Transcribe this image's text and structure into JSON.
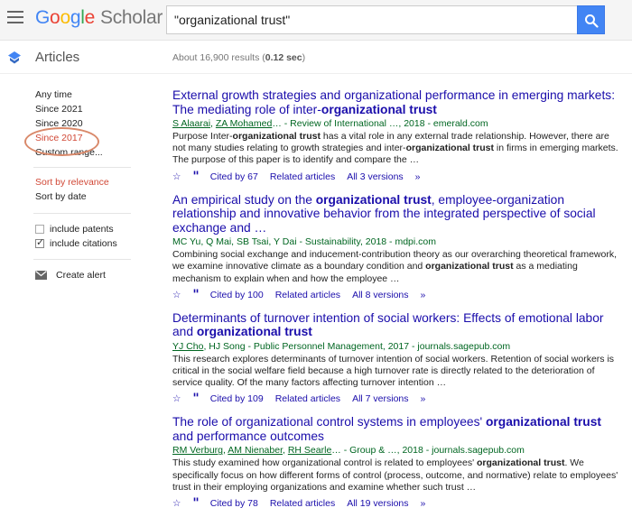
{
  "header": {
    "logo": {
      "g1": "G",
      "g2": "o",
      "g3": "o",
      "g4": "g",
      "g5": "l",
      "g6": "e",
      "scholar": "Scholar"
    },
    "search_value": "\"organizational trust\""
  },
  "subbar": {
    "section_label": "Articles",
    "results_prefix": "About 16,900 results (",
    "results_time": "0.12 sec",
    "results_suffix": ")"
  },
  "sidebar": {
    "time_filters": [
      "Any time",
      "Since 2021",
      "Since 2020",
      "Since 2017",
      "Custom range..."
    ],
    "sort_options": [
      "Sort by relevance",
      "Sort by date"
    ],
    "checkboxes": [
      {
        "label": "include patents",
        "checked": false
      },
      {
        "label": "include citations",
        "checked": true
      }
    ],
    "create_alert": "Create alert"
  },
  "results": [
    {
      "title_parts": [
        "External growth strategies and organizational performance in emerging markets: The mediating role of inter-",
        "organizational trust",
        ""
      ],
      "authors": [
        "S Alaarai",
        "ZA Mohamed"
      ],
      "author_sep": ", ",
      "meta_rest": "… - Review of International …, 2018 - emerald.com",
      "snippet_parts": [
        "Purpose Inter-",
        "organizational trust",
        " has a vital role in any external trade relationship. However, there are not many studies relating to growth strategies and inter-",
        "organizational trust",
        " in firms in emerging markets. The purpose of this paper is to identify and compare the …"
      ],
      "cited_by": "Cited by 67",
      "related": "Related articles",
      "versions": "All 3 versions"
    },
    {
      "title_parts": [
        "An empirical study on the ",
        "organizational trust",
        ", employee-organization relationship and innovative behavior from the integrated perspective of social exchange and …"
      ],
      "authors": [],
      "author_sep": "",
      "meta_rest": "MC Yu, Q Mai, SB Tsai, Y Dai - Sustainability, 2018 - mdpi.com",
      "snippet_parts": [
        "Combining social exchange and inducement-contribution theory as our overarching theoretical framework, we examine innovative climate as a boundary condition and ",
        "organizational trust",
        " as a mediating mechanism to explain when and how the employee …"
      ],
      "cited_by": "Cited by 100",
      "related": "Related articles",
      "versions": "All 8 versions"
    },
    {
      "title_parts": [
        "Determinants of turnover intention of social workers: Effects of emotional labor and ",
        "organizational trust",
        ""
      ],
      "authors": [
        "YJ Cho"
      ],
      "author_sep": ", ",
      "meta_rest": "HJ Song - Public Personnel Management, 2017 - journals.sagepub.com",
      "snippet_parts": [
        "This research explores determinants of turnover intention of social workers. Retention of social workers is critical in the social welfare field because a high turnover rate is directly related to the deterioration of service quality. Of the many factors affecting turnover intention …",
        "",
        ""
      ],
      "cited_by": "Cited by 109",
      "related": "Related articles",
      "versions": "All 7 versions"
    },
    {
      "title_parts": [
        "The role of organizational control systems in employees' ",
        "organizational trust",
        " and performance outcomes"
      ],
      "authors": [
        "RM Verburg",
        "AM Nienaber",
        "RH Searle"
      ],
      "author_sep": ", ",
      "meta_rest": "… - Group & …, 2018 - journals.sagepub.com",
      "snippet_parts": [
        "This study examined how organizational control is related to employees' ",
        "organizational trust",
        ". We specifically focus on how different forms of control (process, outcome, and normative) relate to employees' trust in their employing organizations and examine whether such trust …"
      ],
      "cited_by": "Cited by 78",
      "related": "Related articles",
      "versions": "All 19 versions"
    }
  ]
}
